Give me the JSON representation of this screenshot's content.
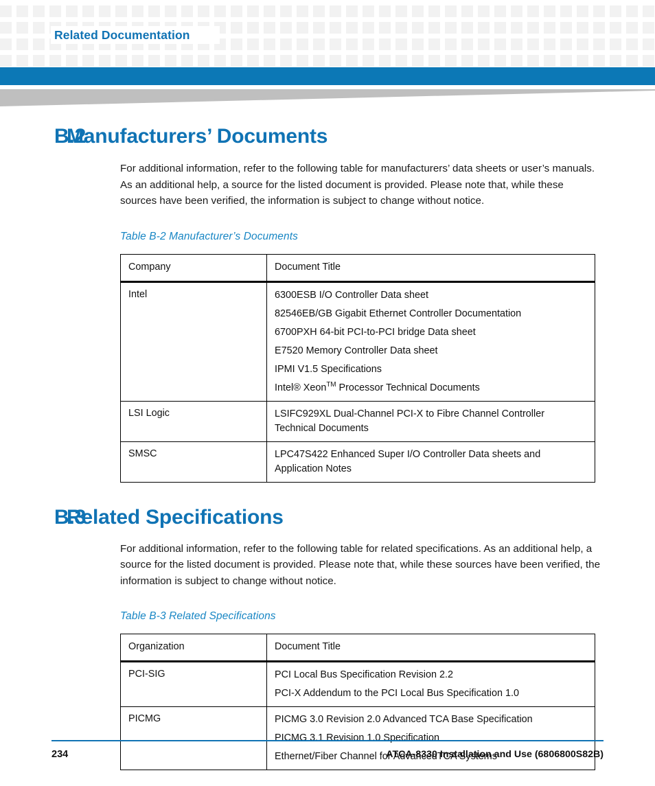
{
  "header": {
    "running_head": "Related Documentation",
    "accent_color": "#1073b4",
    "bar_color": "#0c78b6",
    "wedge_color": "#bfbfbf"
  },
  "sections": [
    {
      "number": "B.2",
      "title": "Manufacturers’ Documents",
      "paragraph": "For additional information, refer to the following table for manufacturers’ data sheets or user’s manuals. As an additional help, a source for the listed document is provided. Please note that, while these sources have been verified, the information is subject to change without notice.",
      "table": {
        "caption": "Table B-2 Manufacturer’s Documents",
        "columns": [
          "Company",
          "Document Title"
        ],
        "rows": [
          {
            "company": "Intel",
            "documents": [
              "6300ESB I/O Controller Data sheet",
              "82546EB/GB Gigabit Ethernet Controller Documentation",
              "6700PXH 64-bit PCI-to-PCI bridge Data sheet",
              "E7520 Memory Controller Data sheet",
              "IPMI V1.5 Specifications"
            ],
            "documents_last_prefix": "Intel® Xeon",
            "documents_last_sup": "TM",
            "documents_last_suffix": " Processor Technical Documents"
          },
          {
            "company": "LSI Logic",
            "documents": [
              "LSIFC929XL Dual-Channel PCI-X to Fibre Channel Controller Technical Documents"
            ]
          },
          {
            "company": "SMSC",
            "documents": [
              "LPC47S422 Enhanced Super I/O Controller Data sheets and Application Notes"
            ]
          }
        ]
      }
    },
    {
      "number": "B.3",
      "title": "Related Specifications",
      "paragraph": "For additional information, refer to the following table for related specifications. As an additional help, a source for the listed document is provided. Please note that, while these sources have been verified, the information is subject to change without notice.",
      "table": {
        "caption": "Table B-3 Related Specifications",
        "columns": [
          "Organization",
          "Document Title"
        ],
        "rows": [
          {
            "company": "PCI-SIG",
            "documents": [
              "PCI Local Bus Specification Revision 2.2",
              "PCI-X Addendum to the PCI Local Bus Specification 1.0"
            ]
          },
          {
            "company": "PICMG",
            "documents": [
              "PICMG 3.0 Revision 2.0 Advanced TCA Base Specification",
              "PICMG 3.1 Revision 1.0 Specification",
              "Ethernet/Fiber Channel for AdvancedTCA Systems"
            ]
          }
        ]
      }
    }
  ],
  "footer": {
    "page_number": "234",
    "doc_title": "ATCA-8330 Installation and Use (6806800S82B)"
  }
}
